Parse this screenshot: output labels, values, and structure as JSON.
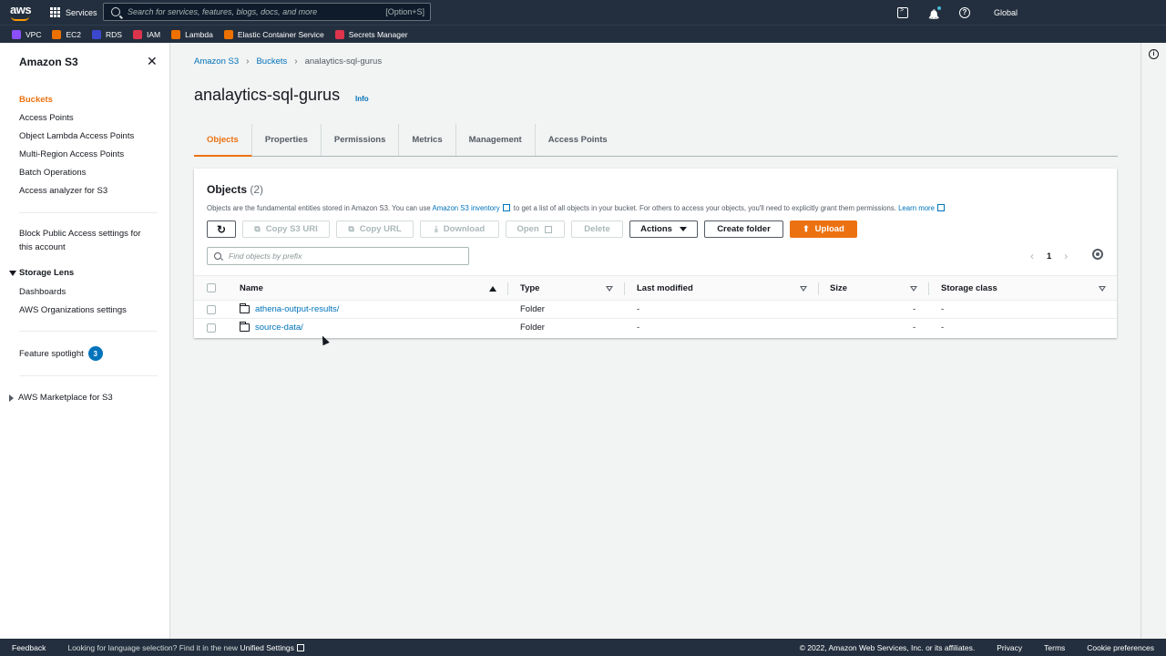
{
  "topnav": {
    "logo": "aws",
    "services_label": "Services",
    "search_placeholder": "Search for services, features, blogs, docs, and more",
    "search_shortcut": "[Option+S]",
    "region": "Global"
  },
  "favorites": [
    {
      "label": "VPC",
      "color": "#8c4fff"
    },
    {
      "label": "EC2",
      "color": "#ed7100"
    },
    {
      "label": "RDS",
      "color": "#3b48cc"
    },
    {
      "label": "IAM",
      "color": "#dd344c"
    },
    {
      "label": "Lambda",
      "color": "#ed7100"
    },
    {
      "label": "Elastic Container Service",
      "color": "#ed7100"
    },
    {
      "label": "Secrets Manager",
      "color": "#dd344c"
    }
  ],
  "sidebar": {
    "title": "Amazon S3",
    "close": "✕",
    "items": [
      "Buckets",
      "Access Points",
      "Object Lambda Access Points",
      "Multi-Region Access Points",
      "Batch Operations",
      "Access analyzer for S3"
    ],
    "block_public_line1": "Block Public Access settings for",
    "block_public_line2": "this account",
    "storage_lens": "Storage Lens",
    "storage_lens_items": [
      "Dashboards",
      "AWS Organizations settings"
    ],
    "feature_spotlight": "Feature spotlight",
    "feature_spotlight_count": "3",
    "marketplace": "AWS Marketplace for S3"
  },
  "breadcrumb": [
    "Amazon S3",
    "Buckets",
    "analaytics-sql-gurus"
  ],
  "page": {
    "title": "analaytics-sql-gurus",
    "info": "Info"
  },
  "tabs": [
    "Objects",
    "Properties",
    "Permissions",
    "Metrics",
    "Management",
    "Access Points"
  ],
  "objects": {
    "title": "Objects",
    "count": "(2)",
    "desc_before": "Objects are the fundamental entities stored in Amazon S3. You can use",
    "desc_link": "Amazon S3 inventory",
    "desc_after": "to get a list of all objects in your bucket. For others to access your objects, you'll need to explicitly grant them permissions.",
    "learn_more": "Learn more",
    "buttons": {
      "refresh": "↻",
      "copy_s3_uri": "Copy S3 URI",
      "copy_url": "Copy URL",
      "download": "Download",
      "open": "Open",
      "delete": "Delete",
      "actions": "Actions",
      "create_folder": "Create folder",
      "upload": "Upload"
    },
    "filter_placeholder": "Find objects by prefix",
    "page_number": "1",
    "columns": [
      "Name",
      "Type",
      "Last modified",
      "Size",
      "Storage class"
    ],
    "rows": [
      {
        "name": "athena-output-results/",
        "type": "Folder",
        "last_modified": "-",
        "size": "-",
        "storage_class": "-"
      },
      {
        "name": "source-data/",
        "type": "Folder",
        "last_modified": "-",
        "size": "-",
        "storage_class": "-"
      }
    ]
  },
  "footer": {
    "feedback": "Feedback",
    "lang_text": "Looking for language selection? Find it in the new",
    "lang_link": "Unified Settings",
    "copyright": "© 2022, Amazon Web Services, Inc. or its affiliates.",
    "privacy": "Privacy",
    "terms": "Terms",
    "cookies": "Cookie preferences"
  },
  "colors": {
    "accent": "#ec7211",
    "link": "#0073bb",
    "nav": "#232f3e"
  }
}
